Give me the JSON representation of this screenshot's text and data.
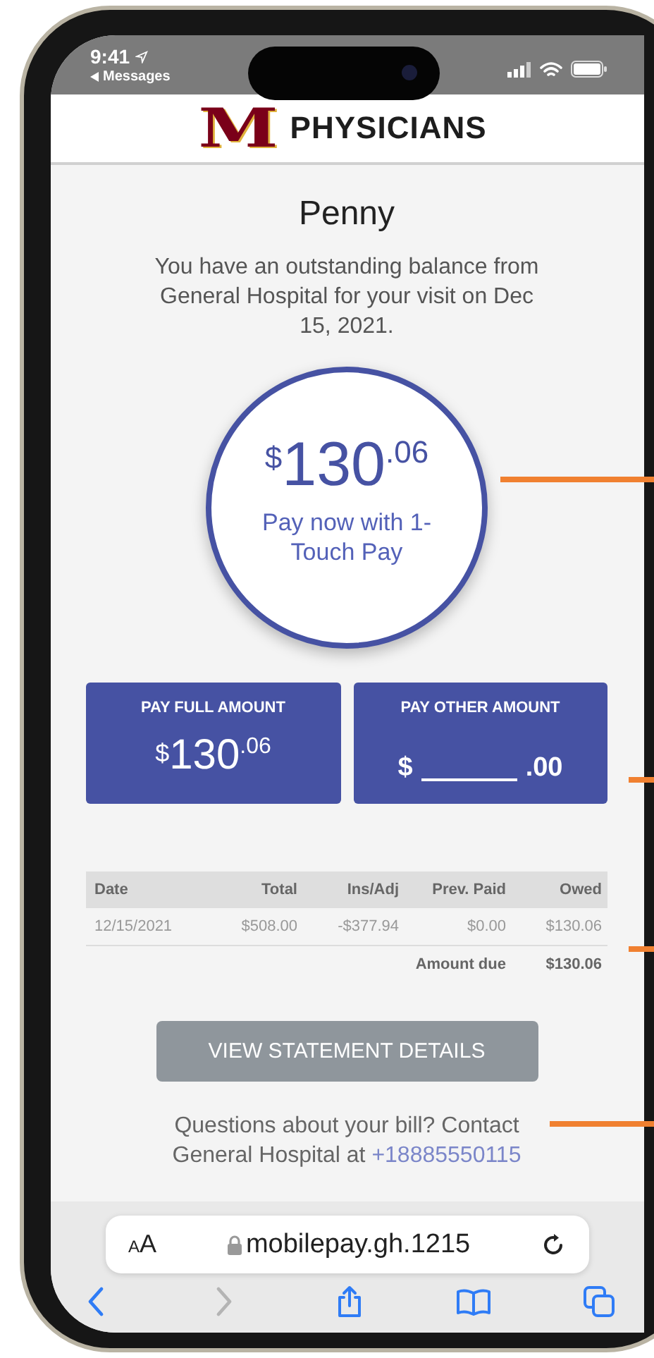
{
  "status_bar": {
    "time": "9:41",
    "back_label": "Messages"
  },
  "header": {
    "logo_mark": "M",
    "logo_text": "PHYSICIANS"
  },
  "patient_name": "Penny",
  "message": "You have an outstanding balance from General Hospital for your visit on Dec 15, 2021.",
  "balance_circle": {
    "currency": "$",
    "dollars": "130",
    "cents": ".06",
    "caption": "Pay now with 1-Touch Pay"
  },
  "pay_options": [
    {
      "kind": "amount",
      "label": "PAY FULL AMOUNT",
      "currency": "$",
      "dollars": "130",
      "cents": ".06"
    },
    {
      "kind": "input",
      "label": "PAY OTHER AMOUNT",
      "currency": "$",
      "cents": ".00"
    }
  ],
  "table": {
    "columns": [
      "Date",
      "Total",
      "Ins/Adj",
      "Prev. Paid",
      "Owed"
    ],
    "rows": [
      [
        "12/15/2021",
        "$508.00",
        "-$377.94",
        "$0.00",
        "$130.06"
      ]
    ],
    "total_label": "Amount due",
    "total_value": "$130.06"
  },
  "details_button": "VIEW STATEMENT DETAILS",
  "contact": {
    "text": "Questions about your bill? Contact General Hospital at",
    "phone": "+18885550115"
  },
  "browser": {
    "text_size": "AA",
    "url": "mobilepay.gh.1215",
    "toolbar": [
      {
        "kind": "back",
        "disabled": false
      },
      {
        "kind": "forward",
        "disabled": true
      },
      {
        "kind": "share",
        "disabled": false
      },
      {
        "kind": "bookmarks",
        "disabled": false
      },
      {
        "kind": "tabs",
        "disabled": false
      }
    ]
  }
}
